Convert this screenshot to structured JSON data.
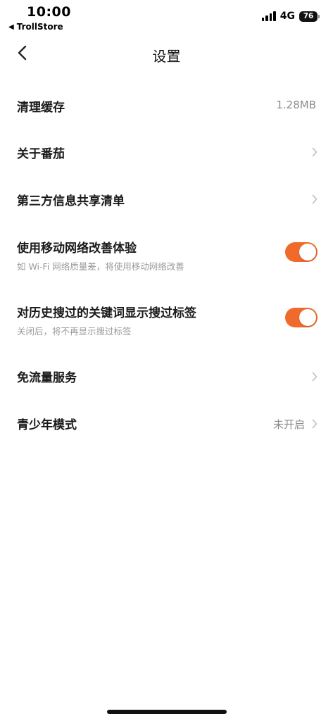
{
  "status_bar": {
    "time": "10:00",
    "back_app": "TrollStore",
    "network": "4G",
    "battery": "76"
  },
  "nav": {
    "title": "设置"
  },
  "settings": {
    "clear_cache": {
      "label": "清理缓存",
      "value": "1.28MB"
    },
    "about": {
      "label": "关于番茄"
    },
    "third_party": {
      "label": "第三方信息共享清单"
    },
    "mobile_network": {
      "label": "使用移动网络改善体验",
      "sub": "如 Wi-Fi 网络质量差，将使用移动网络改善",
      "enabled": true
    },
    "search_tags": {
      "label": "对历史搜过的关键词显示搜过标签",
      "sub": "关闭后，将不再显示搜过标签",
      "enabled": true
    },
    "free_data": {
      "label": "免流量服务"
    },
    "teen_mode": {
      "label": "青少年模式",
      "value": "未开启"
    }
  },
  "colors": {
    "accent": "#f06a2b"
  },
  "icons": {
    "back": "chevron-left-icon",
    "chevron": "chevron-right-icon",
    "signal": "cellular-signal-icon",
    "battery": "battery-icon"
  }
}
